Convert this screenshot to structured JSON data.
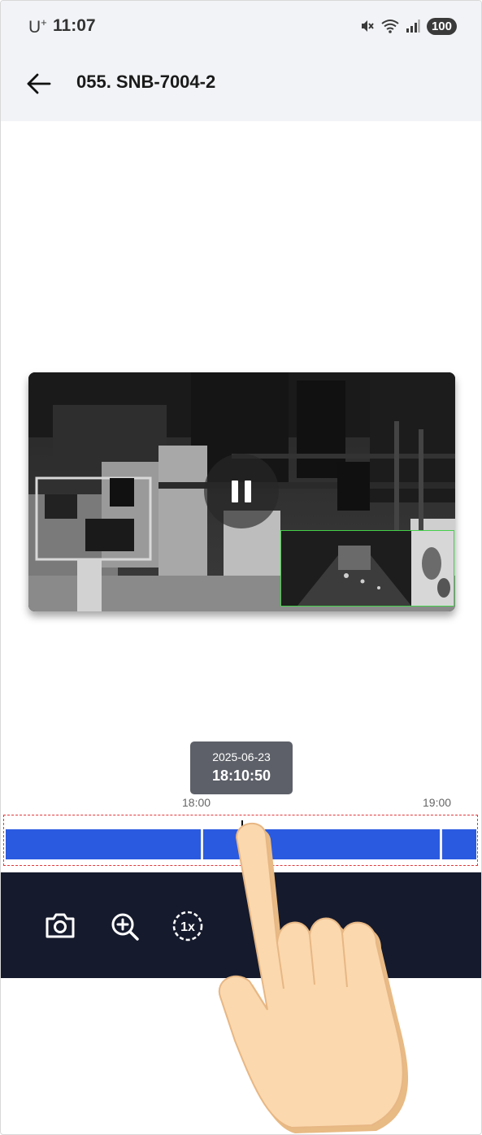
{
  "status_bar": {
    "carrier": "U",
    "carrier_sup": "+",
    "time": "11:07",
    "battery": "100"
  },
  "header": {
    "title": "055. SNB-7004-2"
  },
  "player": {
    "state": "playing",
    "pause_icon": "pause-icon",
    "motion_box_color": "#45d04a"
  },
  "tooltip": {
    "date": "2025-06-23",
    "time": "18:10:50"
  },
  "timeline": {
    "ticks": [
      "18:00",
      "19:00"
    ],
    "bar_color": "#2a5ae0",
    "highlight_color": "#e2393c"
  },
  "toolbar": {
    "tools": [
      "camera-icon",
      "zoom-in-icon",
      "playback-speed-icon"
    ],
    "speed_label": "1x"
  },
  "colors": {
    "header_bg": "#f2f3f6",
    "toolbar_bg": "#151a2c"
  }
}
